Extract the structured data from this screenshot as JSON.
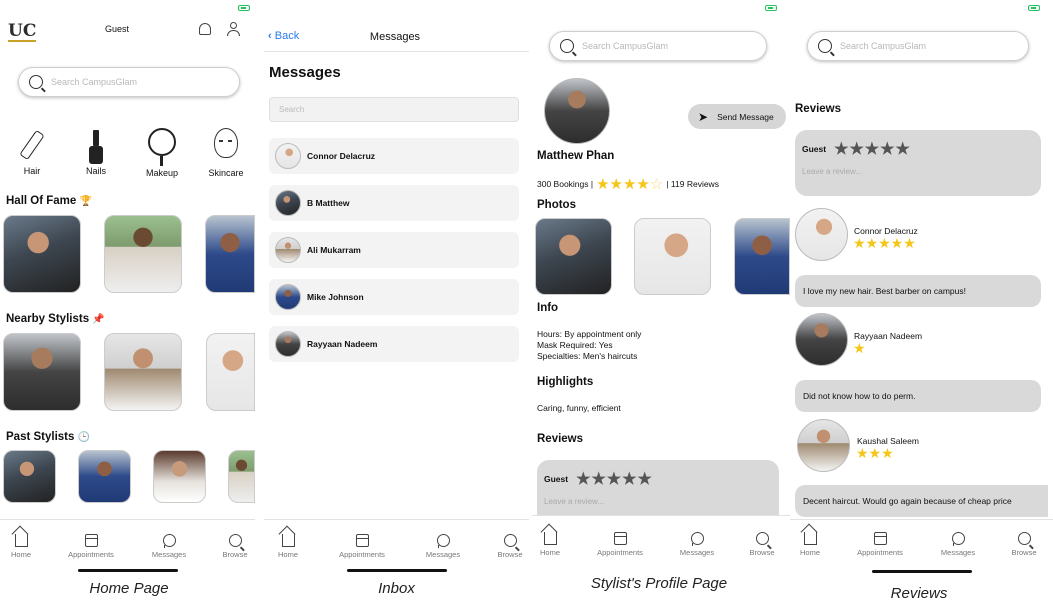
{
  "captions": [
    "Home Page",
    "Inbox",
    "Stylist's Profile Page",
    "Reviews"
  ],
  "home": {
    "logo": "UC",
    "user": "Guest",
    "search_placeholder": "Search CampusGlam",
    "categories": [
      "Hair",
      "Nails",
      "Makeup",
      "Skincare"
    ],
    "hall_of_fame": "Hall Of Fame",
    "hall_icon": "🏆",
    "nearby": "Nearby Stylists",
    "nearby_icon": "📌",
    "past": "Past Stylists",
    "past_icon": "🕒"
  },
  "tabs": [
    "Home",
    "Appointments",
    "Messages",
    "Browse"
  ],
  "inbox": {
    "back": "Back",
    "nav_title": "Messages",
    "heading": "Messages",
    "search_placeholder": "Search",
    "conversations": [
      "Connor Delacruz",
      "B Matthew",
      "Ali Mukarram",
      "Mike Johnson",
      "Rayyaan Nadeem"
    ]
  },
  "profile": {
    "search_placeholder": "Search CampusGlam",
    "send_message": "Send Message",
    "name": "Matthew Phan",
    "bookings": "300 Bookings |",
    "rating_stars": 4.5,
    "reviews_count": "| 119 Reviews",
    "photos_heading": "Photos",
    "info_heading": "Info",
    "info_lines": [
      "Hours: By appointment only",
      "Mask Required: Yes",
      "Specialties: Men's haircuts"
    ],
    "highlights_heading": "Highlights",
    "highlights": "Caring, funny, efficient",
    "reviews_heading": "Reviews",
    "guest": "Guest",
    "leave_review": "Leave a review..."
  },
  "reviews": {
    "search_placeholder": "Search CampusGlam",
    "heading": "Reviews",
    "guest": "Guest",
    "leave_review": "Leave a review...",
    "items": [
      {
        "name": "Connor Delacruz",
        "stars": "★★★★★",
        "text": "I love my new hair. Best barber on campus!"
      },
      {
        "name": "Rayyaan Nadeem",
        "stars": "★",
        "text": "Did not know how to do perm."
      },
      {
        "name": "Kaushal Saleem",
        "stars": "★★★",
        "text": "Decent haircut. Would go again because of cheap price"
      }
    ]
  }
}
